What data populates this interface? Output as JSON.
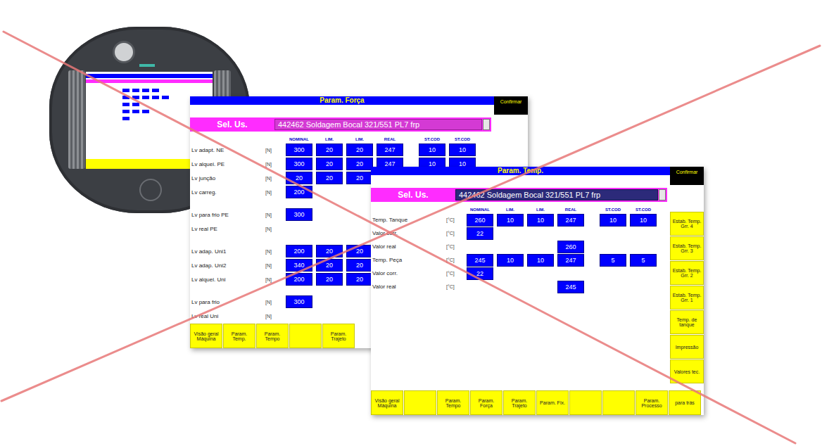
{
  "device": {
    "kind": "mobile-panel"
  },
  "overlay": {
    "crossed_out": true
  },
  "windows": [
    {
      "title": "Param. Força",
      "confirm": "Confirmar",
      "selector": {
        "label": "Sel. Us.",
        "value": "442462 Soldagem Bocal 321/551 PL7 frp",
        "focused": false
      },
      "columns": [
        "NOMINAL",
        "LIM.",
        "LIM.",
        "REAL",
        "ST.COD",
        "ST.COD"
      ],
      "groups": [
        [
          {
            "label": "Lv adapt. NE",
            "unit": "[N]",
            "values": [
              "300",
              "20",
              "20",
              "247",
              "10",
              "10"
            ]
          },
          {
            "label": "Lv alquei. PE",
            "unit": "[N]",
            "values": [
              "300",
              "20",
              "20",
              "247",
              "10",
              "10"
            ]
          },
          {
            "label": "Lv junção",
            "unit": "[N]",
            "values": [
              "20",
              "20",
              "20",
              "",
              "",
              ""
            ]
          },
          {
            "label": "Lv carreg.",
            "unit": "[N]",
            "values": [
              "200",
              "",
              "",
              "",
              "",
              ""
            ]
          }
        ],
        [
          {
            "label": "Lv para frio PE",
            "unit": "[N]",
            "values": [
              "300",
              "",
              "",
              "",
              "",
              ""
            ]
          },
          {
            "label": "Lv real PE",
            "unit": "[N]",
            "values": [
              "",
              "",
              "",
              "",
              "",
              ""
            ]
          }
        ],
        [
          {
            "label": "Lv adap. Uni1",
            "unit": "[N]",
            "values": [
              "200",
              "20",
              "20",
              "",
              "",
              ""
            ]
          },
          {
            "label": "Lv adap. Uni2",
            "unit": "[N]",
            "values": [
              "340",
              "20",
              "20",
              "",
              "",
              ""
            ]
          },
          {
            "label": "Lv alquei. Uni",
            "unit": "[N]",
            "values": [
              "200",
              "20",
              "20",
              "",
              "",
              ""
            ]
          }
        ],
        [
          {
            "label": "Lv para frio",
            "unit": "[N]",
            "values": [
              "300",
              "",
              "",
              "",
              "",
              ""
            ]
          },
          {
            "label": "Lv real Uni",
            "unit": "[N]",
            "values": [
              "",
              "",
              "",
              "",
              "",
              ""
            ]
          }
        ]
      ],
      "side_buttons": [],
      "bottom_buttons": [
        "Visão geral Máquina",
        "Param. Temp.",
        "Param. Tempo",
        "",
        "Param. Trajeto"
      ]
    },
    {
      "title": "Param. Temp.",
      "confirm": "Confirmar",
      "selector": {
        "label": "Sel. Us.",
        "value": "442462 Soldagem Bocal 321/551 PL7 frp",
        "focused": true
      },
      "columns": [
        "NOMINAL",
        "LIM.",
        "LIM.",
        "REAL",
        "ST.COD",
        "ST.COD"
      ],
      "groups": [
        [
          {
            "label": "Temp. Tanque",
            "unit": "[°C]",
            "values": [
              "260",
              "10",
              "10",
              "247",
              "10",
              "10"
            ]
          },
          {
            "label": "Valor corr.",
            "unit": "[°C]",
            "values": [
              "22",
              "",
              "",
              "",
              "",
              ""
            ]
          },
          {
            "label": "Valor real",
            "unit": "[°C]",
            "values": [
              "",
              "",
              "",
              "260",
              "",
              ""
            ]
          },
          {
            "label": "Temp. Peça",
            "unit": "[°C]",
            "values": [
              "245",
              "10",
              "10",
              "247",
              "5",
              "5"
            ]
          },
          {
            "label": "Valor corr.",
            "unit": "[°C]",
            "values": [
              "22",
              "",
              "",
              "",
              "",
              ""
            ]
          },
          {
            "label": "Valor real",
            "unit": "[°C]",
            "values": [
              "",
              "",
              "",
              "245",
              "",
              ""
            ]
          }
        ]
      ],
      "side_buttons": [
        "Estab. Temp. Grr. 4",
        "Estab. Temp. Grr. 3",
        "Estab. Temp. Grr. 2",
        "Estab. Temp. Grr. 1",
        "Temp. de tanque",
        "Impressão",
        "Valores tec."
      ],
      "bottom_buttons": [
        "Visão geral Máquina",
        "",
        "Param. Tempo",
        "Param. Força",
        "Param. Trajeto",
        "Param. Fix.",
        "",
        "",
        "Param. Processo",
        "para trás"
      ]
    }
  ]
}
